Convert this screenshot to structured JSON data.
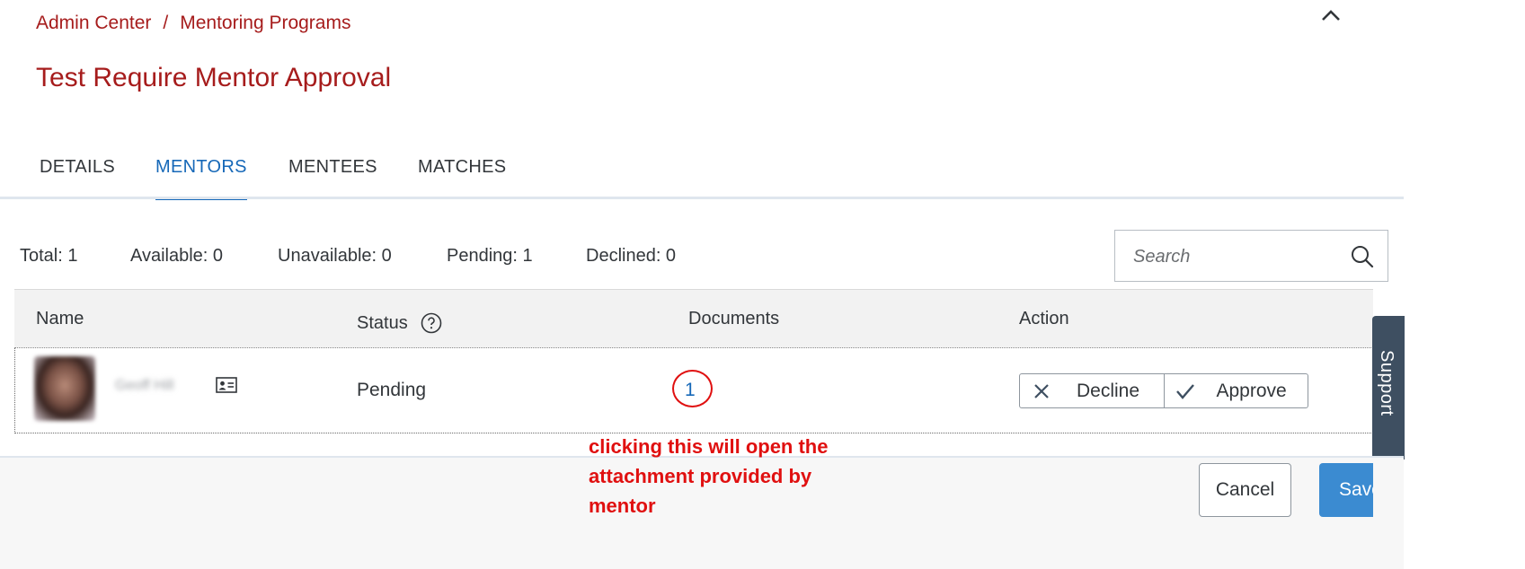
{
  "breadcrumb": {
    "items": [
      "Admin Center",
      "Mentoring Programs"
    ],
    "separator": "/"
  },
  "page_title": "Test Require Mentor Approval",
  "tabs": [
    {
      "label": "DETAILS",
      "active": false
    },
    {
      "label": "MENTORS",
      "active": true
    },
    {
      "label": "MENTEES",
      "active": false
    },
    {
      "label": "MATCHES",
      "active": false
    }
  ],
  "summary": {
    "total": "Total: 1",
    "available": "Available: 0",
    "unavailable": "Unavailable: 0",
    "pending": "Pending: 1",
    "declined": "Declined: 0"
  },
  "search": {
    "placeholder": "Search",
    "value": ""
  },
  "table": {
    "headers": {
      "name": "Name",
      "status": "Status",
      "documents": "Documents",
      "action": "Action"
    },
    "rows": [
      {
        "name": "Geoff Hill",
        "status": "Pending",
        "documents": "1",
        "actions": {
          "decline": "Decline",
          "approve": "Approve"
        }
      }
    ]
  },
  "annotation": "clicking this will open the attachment provided by mentor",
  "support_label": "Support",
  "footer": {
    "cancel": "Cancel",
    "save": "Save"
  },
  "colors": {
    "brand_red": "#a61c1c",
    "link_blue": "#1668b8",
    "annotation_red": "#e01010",
    "primary_button": "#3b8bd1",
    "support_tab": "#3e4f61"
  },
  "icons": {
    "collapse": "chevron-up-icon",
    "status_help": "question-circle-icon",
    "contact_card": "contact-card-icon",
    "search": "search-icon",
    "decline": "close-icon",
    "approve": "checkmark-icon"
  }
}
